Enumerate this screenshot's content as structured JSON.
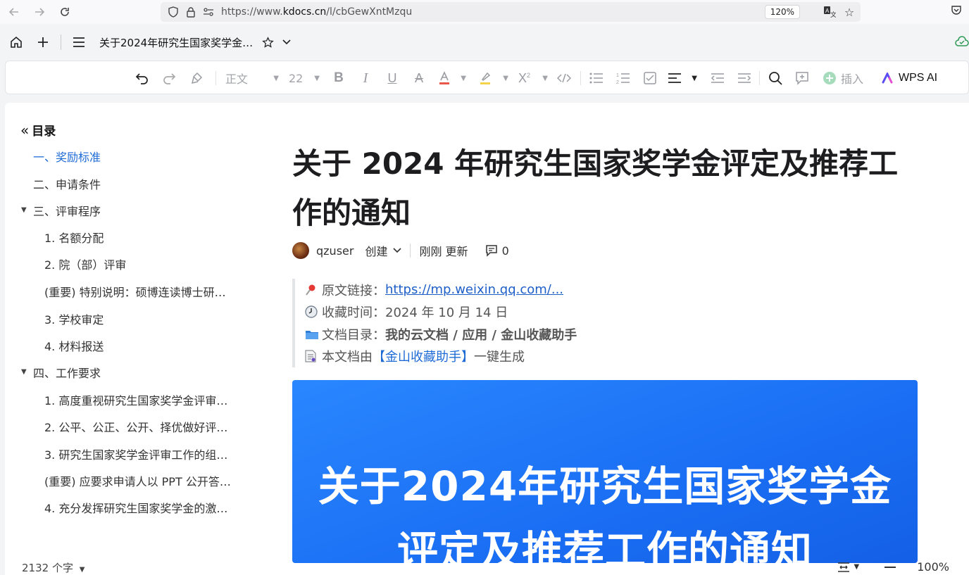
{
  "browser": {
    "url_prefix": "https://www.",
    "url_domain": "kdocs.cn",
    "url_path": "/l/cbGewXntMzqu",
    "zoom": "120%"
  },
  "header": {
    "doc_title": "关于2024年研究生国家奖学金…"
  },
  "toolbar": {
    "style_select": "正文",
    "size_select": "22",
    "insert_label": "插入",
    "wps_ai_label": "WPS AI"
  },
  "toc": {
    "title": "目录",
    "items": [
      "一、奖励标准",
      "二、申请条件",
      "三、评审程序",
      "1. 名额分配",
      "2. 院（部）评审",
      "(重要) 特别说明：硕博连读博士研…",
      "3. 学校审定",
      "4. 材料报送",
      "四、工作要求",
      "1. 高度重视研究生国家奖学金评审…",
      "2. 公平、公正、公开、择优做好评…",
      "3. 研究生国家奖学金评审工作的组…",
      "(重要) 应要求申请人以 PPT 公开答…",
      "4. 充分发挥研究生国家奖学金的激…"
    ]
  },
  "document": {
    "title": "关于 2024 年研究生国家奖学金评定及推荐工作的通知",
    "author": "qzuser",
    "created_label": "创建",
    "updated_label": "刚刚 更新",
    "comment_count": "0",
    "quote": {
      "source_label": "原文链接：",
      "source_link": "https://mp.weixin.qq.com/...",
      "time_label": "收藏时间：",
      "time_value": "2024 年 10 月 14 日",
      "dir_label": "文档目录：",
      "dir_value": "我的云文档 / 应用 / 金山收藏助手",
      "gen_prefix": "本文档由",
      "gen_name": "【金山收藏助手】",
      "gen_suffix": "一键生成"
    },
    "banner_line1": "关于2024年研究生国家奖学金",
    "banner_line2": "评定及推荐工作的通知"
  },
  "status": {
    "word_count": "2132 个字",
    "zoom": "100%"
  },
  "colors": {
    "accent": "#1f6bd6",
    "banner_blue": "#1a6ef3",
    "link": "#1f5fc8"
  }
}
